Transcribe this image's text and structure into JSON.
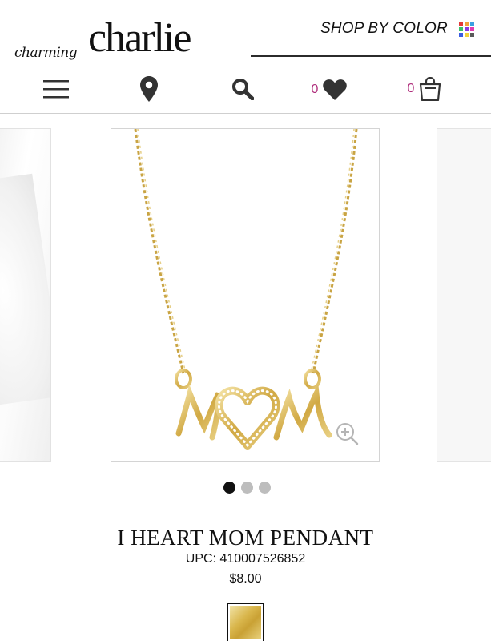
{
  "brand": {
    "script": "charming",
    "name": "charlie"
  },
  "header": {
    "shop_by_color": "SHOP BY COLOR",
    "palette_colors": [
      "#e23a3a",
      "#f2a23a",
      "#3aa0e2",
      "#3ac26b",
      "#8a3ae2",
      "#e23ab0",
      "#3a5ce2",
      "#f2d23a",
      "#5a5a5a"
    ]
  },
  "nav": {
    "menu_icon": "hamburger-icon",
    "location_icon": "map-pin-icon",
    "search_icon": "search-icon",
    "wishlist_count": "0",
    "wishlist_icon": "heart-icon",
    "cart_count": "0",
    "cart_icon": "shopping-bag-icon",
    "accent_color": "#b0307d"
  },
  "carousel": {
    "image_subject": "gold MOM pendant necklace with crystal heart",
    "zoom_icon": "zoom-in-icon",
    "slides_count": 3,
    "active_slide": 1
  },
  "product": {
    "title": "I HEART MOM PENDANT",
    "upc": "UPC: 410007526852",
    "price": "$8.00",
    "swatch_color": "#d9b64c"
  }
}
